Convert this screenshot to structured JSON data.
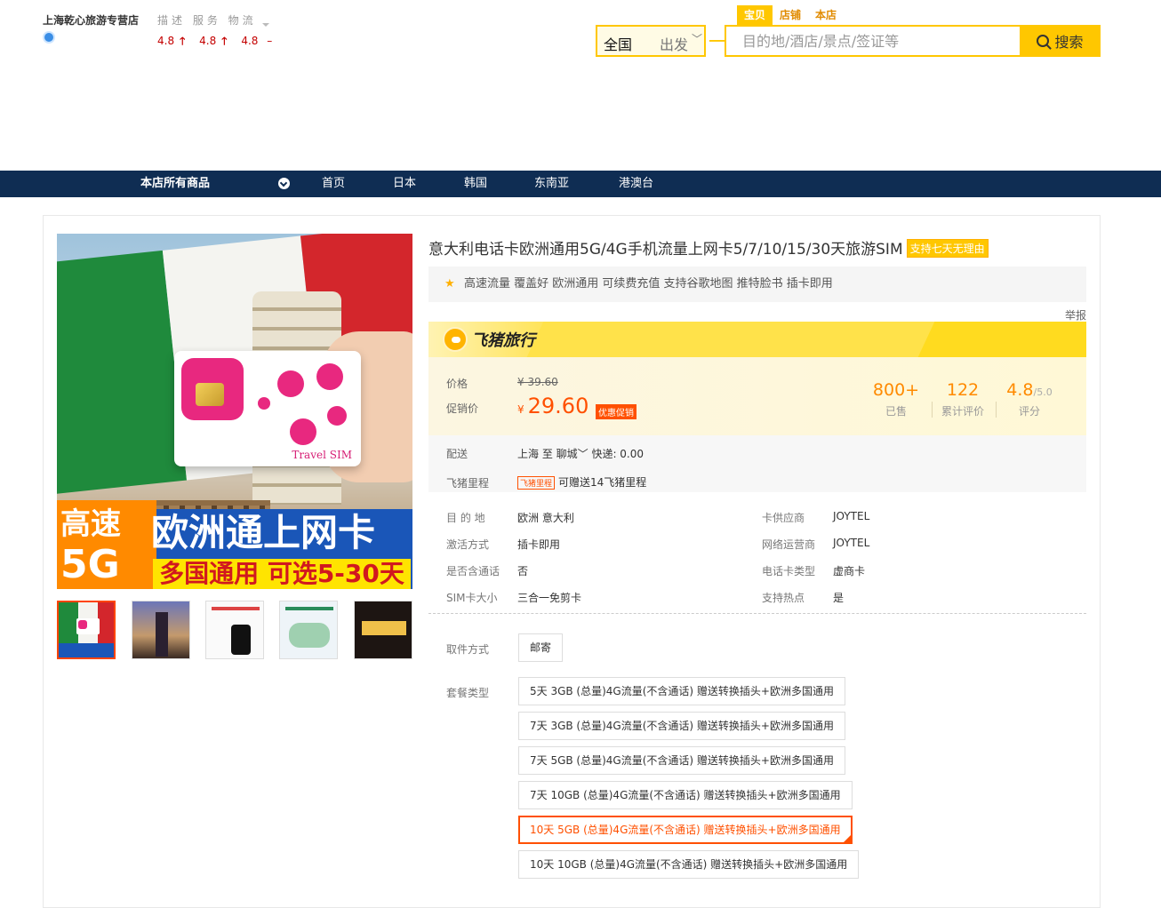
{
  "shop": {
    "name": "上海乾心旅游专营店",
    "rating_labels": "描述 服务 物流",
    "ratings": [
      "4.8",
      "4.8",
      "4.8"
    ],
    "arrows": [
      "🡑",
      "🡑",
      "–"
    ]
  },
  "search": {
    "tabs": [
      "宝贝",
      "店铺",
      "本店"
    ],
    "region": "全国",
    "depart": "出发",
    "placeholder": "目的地/酒店/景点/签证等",
    "button": "搜索"
  },
  "nav": {
    "all": "本店所有商品",
    "items": [
      "首页",
      "日本",
      "韩国",
      "东南亚",
      "港澳台"
    ]
  },
  "banner": {
    "line1": "高速",
    "line2": "5G",
    "title": "欧洲通上网卡",
    "sub": "多国通用 可选5-30天",
    "sim_label": "Travel SIM"
  },
  "product": {
    "title": "意大利电话卡欧洲通用5G/4G手机流量上网卡5/7/10/15/30天旅游SIM",
    "badge": "支持七天无理由",
    "features": "高速流量 覆盖好 欧洲通用 可续费充值 支持谷歌地图 推特脸书 插卡即用",
    "report": "举报",
    "brand": "飞猪旅行"
  },
  "price": {
    "label": "价格",
    "original": "¥ 39.60",
    "promo_label": "促销价",
    "currency": "¥",
    "promo": "29.60",
    "promo_tag": "优惠促销"
  },
  "stats": [
    {
      "value": "800+",
      "suffix": "",
      "label": "已售"
    },
    {
      "value": "122",
      "suffix": "",
      "label": "累计评价"
    },
    {
      "value": "4.8",
      "suffix": "/5.0",
      "label": "评分"
    }
  ],
  "shipping": {
    "label": "配送",
    "value": "上海 至 聊城﹀  快递: 0.00",
    "mileage_label": "飞猪里程",
    "mileage_tag": "飞猪里程",
    "mileage_value": "可赠送14飞猪里程"
  },
  "attributes": [
    {
      "label": "目 的 地",
      "value": "欧洲    意大利"
    },
    {
      "label": "卡供应商",
      "value": "JOYTEL"
    },
    {
      "label": "激活方式",
      "value": "插卡即用"
    },
    {
      "label": "网络运营商",
      "value": "JOYTEL"
    },
    {
      "label": "是否含通话",
      "value": "否"
    },
    {
      "label": "电话卡类型",
      "value": "虚商卡"
    },
    {
      "label": "SIM卡大小",
      "value": "三合一免剪卡"
    },
    {
      "label": "支持热点",
      "value": "是"
    }
  ],
  "options": {
    "pickup_label": "取件方式",
    "pickup_value": "邮寄",
    "package_label": "套餐类型",
    "packages": [
      "5天 3GB (总量)4G流量(不含通话) 赠送转换插头+欧洲多国通用",
      "7天 3GB (总量)4G流量(不含通话) 赠送转换插头+欧洲多国通用",
      "7天 5GB (总量)4G流量(不含通话) 赠送转换插头+欧洲多国通用",
      "7天 10GB (总量)4G流量(不含通话) 赠送转换插头+欧洲多国通用",
      "10天 5GB (总量)4G流量(不含通话) 赠送转换插头+欧洲多国通用",
      "10天 10GB (总量)4G流量(不含通话) 赠送转换插头+欧洲多国通用"
    ],
    "selected_index": 4
  },
  "colors": {
    "accent": "#ffc700",
    "nav_bg": "#0f2d53",
    "price": "#ff5000",
    "stat": "#ff8a00"
  }
}
